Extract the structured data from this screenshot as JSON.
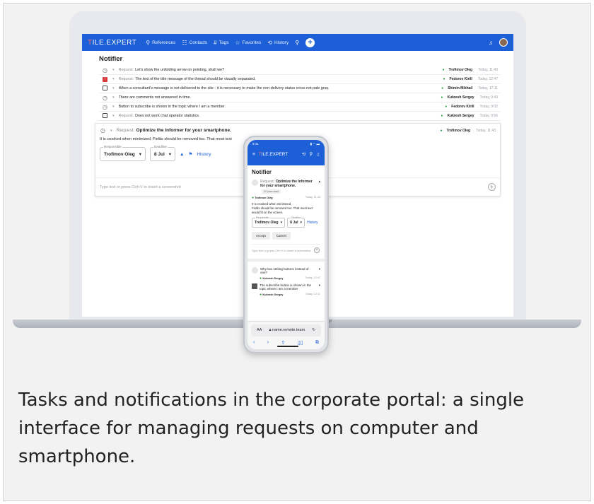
{
  "desktop": {
    "logo": {
      "t": "T",
      "rest": "ILE.EXPERT"
    },
    "nav": [
      {
        "icon": "link-icon",
        "glyph": "⚲",
        "label": "References"
      },
      {
        "icon": "contacts-icon",
        "glyph": "☷",
        "label": "Contacts"
      },
      {
        "icon": "hashtag-icon",
        "glyph": "#",
        "label": "Tags"
      },
      {
        "icon": "star-icon",
        "glyph": "☆",
        "label": "Favorites"
      },
      {
        "icon": "history-icon",
        "glyph": "⟲",
        "label": "History"
      }
    ],
    "page_title": "Notifier",
    "rows": [
      {
        "icon": "clock",
        "prefix": "Request:",
        "title": "Let's show the unfolding arrow on pointing, shall we?",
        "owner": "Trofimov Oleg",
        "time": "Today, 11:43"
      },
      {
        "icon": "alert",
        "prefix": "Request:",
        "title": "The text of the title message of the thread should be visually separated.",
        "owner": "Fedorov Kirill",
        "time": "Today, 12:47"
      },
      {
        "icon": "check",
        "prefix": "",
        "title": "When a consultant's message is not delivered to the site - it is necessary to make the non-delivery status cross not pale gray.",
        "owner": "Shimin Mikhail",
        "time": "Today, 17:11"
      },
      {
        "icon": "clock",
        "prefix": "",
        "title": "There are comments not answered in time.",
        "owner": "Kukresh Sergey",
        "time": "Today, 9:49"
      },
      {
        "icon": "clock",
        "prefix": "",
        "title": "Button to subscribe is shown in the topic where I am a member.",
        "owner": "Fedorov Kirill",
        "time": "Today, 9:02"
      },
      {
        "icon": "check",
        "prefix": "Request:",
        "title": "Does not work chat operator statistics.",
        "owner": "Kukresh Sergey",
        "time": "Today, 9:56"
      }
    ],
    "expanded": {
      "prefix": "Request:",
      "title": "Optimize the Informer for your smartphone.",
      "owner": "Trofimov Oleg",
      "time": "Today, 11:43",
      "body": "It is crooked when minimized. Fields should be removed too. That most text",
      "responsible_label": "Responsible",
      "responsible_value": "Trofimov Oleg",
      "deadline_label": "Deadline",
      "deadline_value": "8 Jul",
      "history": "History",
      "placeholder": "Type text or press Ctrl+V to insert a screenshot"
    }
  },
  "phone": {
    "time": "9:41",
    "logo": {
      "t": "T",
      "rest": "ILE.EXPERT"
    },
    "title": "Notifier",
    "card": {
      "prefix": "Request:",
      "title": "Optimize the Informer for your smartphone.",
      "tag": "42 участника",
      "owner": "Trofimov Oleg",
      "time": "Today, 11:43",
      "body1": "It is crooked when minimized.",
      "body2": "Fields should be removed too. That most text would fit on the screen.",
      "responsible_label": "Responsible",
      "responsible_value": "Trofimov Oleg",
      "deadline_label": "Deadline",
      "deadline_value": "8 Jul",
      "history": "History",
      "accept": "Accept",
      "cancel": "Cancel",
      "placeholder": "Type text or press Ctrl+V to insert a screenshot"
    },
    "items": [
      {
        "title": "Why two setting buttons instead of one?",
        "owner": "Kukresh Sergey",
        "time": "Today, 12:47"
      },
      {
        "title": "The subscribe button is shown in the topic where I am a member",
        "owner": "Kukresh Sergey",
        "time": "Today, 12:11"
      }
    ],
    "browser": {
      "aa": "AA",
      "url": "name.remote.team"
    }
  },
  "caption": "Tasks and notifications in the corporate portal: a single interface for managing requests on computer and smartphone."
}
